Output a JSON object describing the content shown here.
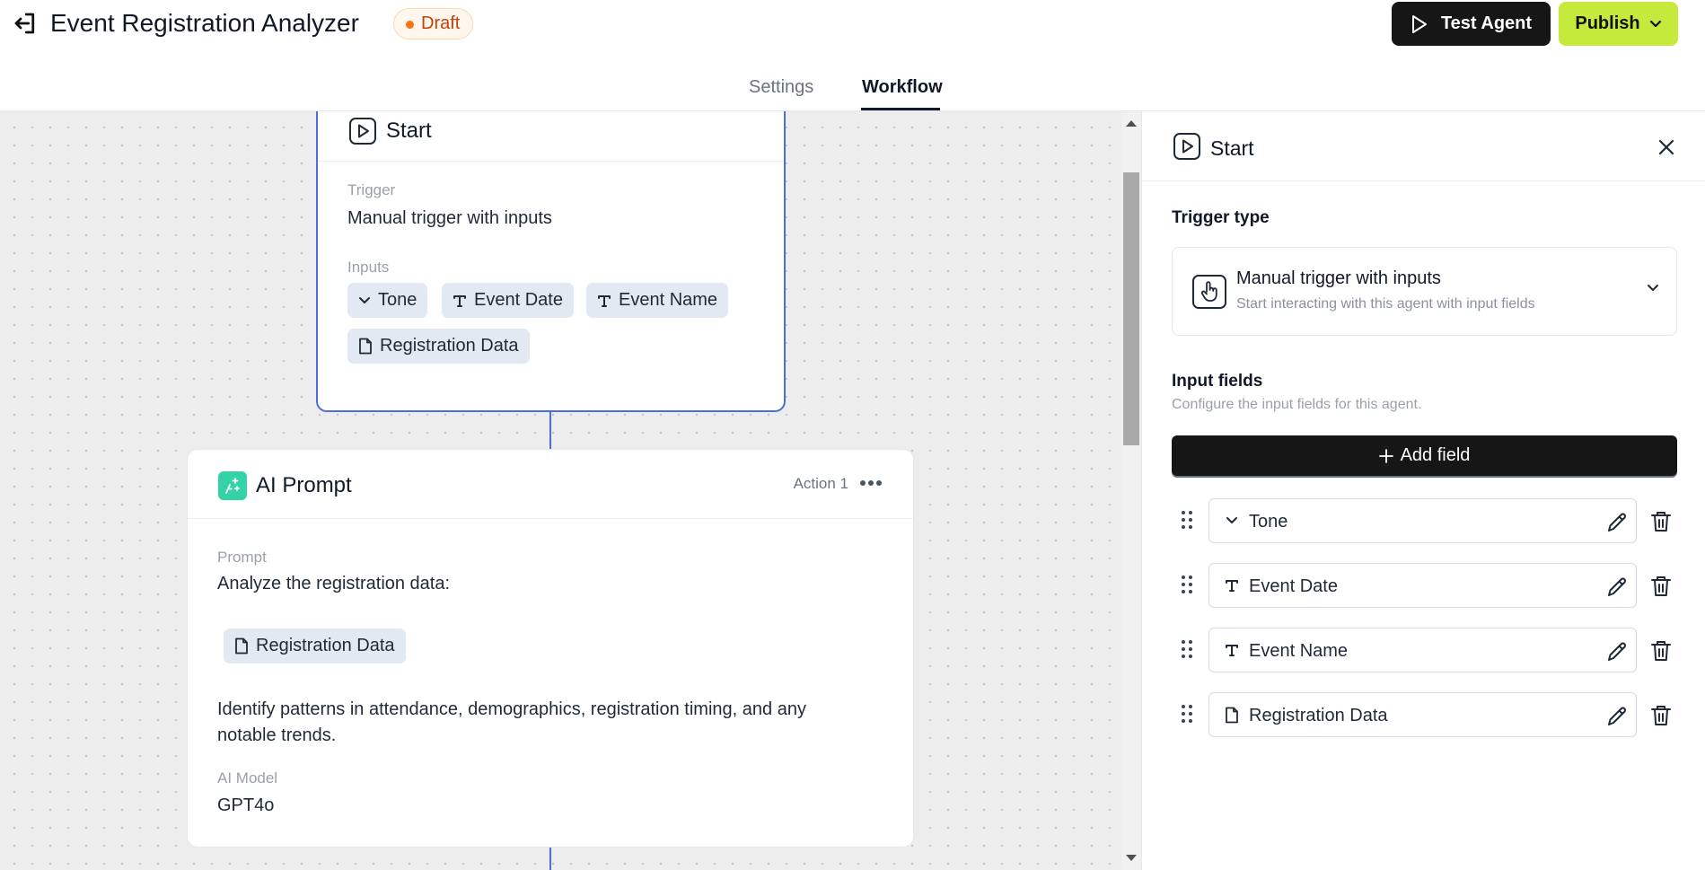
{
  "header": {
    "title": "Event Registration Analyzer",
    "status": "Draft",
    "test_label": "Test Agent",
    "publish_label": "Publish"
  },
  "tabs": [
    {
      "label": "Settings",
      "active": false
    },
    {
      "label": "Workflow",
      "active": true
    }
  ],
  "start_node": {
    "title": "Start",
    "trigger_label": "Trigger",
    "trigger_value": "Manual trigger with inputs",
    "inputs_label": "Inputs",
    "inputs": [
      {
        "label": "Tone",
        "icon": "chevron-down-icon"
      },
      {
        "label": "Event Date",
        "icon": "text-type-icon"
      },
      {
        "label": "Event Name",
        "icon": "text-type-icon"
      },
      {
        "label": "Registration Data",
        "icon": "file-icon"
      }
    ]
  },
  "ai_node": {
    "title": "AI Prompt",
    "action": "Action 1",
    "prompt_label": "Prompt",
    "prompt_intro": "Analyze the registration data:",
    "prompt_chip": "Registration Data",
    "prompt_body": "Identify patterns in attendance, demographics, registration timing, and any notable trends.",
    "model_label": "AI Model",
    "model_value": "GPT4o"
  },
  "panel": {
    "title": "Start",
    "trigger_type_label": "Trigger type",
    "trigger_name": "Manual trigger with inputs",
    "trigger_desc": "Start interacting with this agent with input fields",
    "input_fields_label": "Input fields",
    "input_fields_sub": "Configure the input fields for this agent.",
    "add_field_label": "Add field",
    "fields": [
      {
        "name": "Tone",
        "icon": "chevron-down-icon"
      },
      {
        "name": "Event Date",
        "icon": "text-type-icon"
      },
      {
        "name": "Event Name",
        "icon": "text-type-icon"
      },
      {
        "name": "Registration Data",
        "icon": "file-icon"
      }
    ]
  },
  "colors": {
    "accent_blue": "#4a6fd8",
    "publish_green": "#c5ea3b",
    "draft_orange": "#f97316",
    "ai_teal": "#34d3a6"
  }
}
